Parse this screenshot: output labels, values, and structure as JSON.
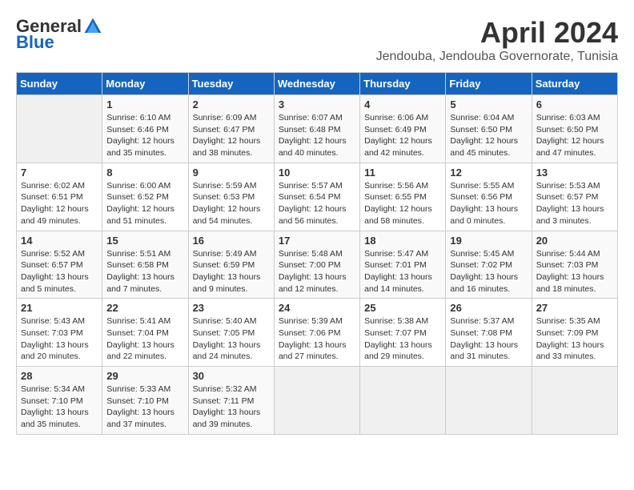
{
  "header": {
    "logo_general": "General",
    "logo_blue": "Blue",
    "month_title": "April 2024",
    "subtitle": "Jendouba, Jendouba Governorate, Tunisia"
  },
  "calendar": {
    "days_of_week": [
      "Sunday",
      "Monday",
      "Tuesday",
      "Wednesday",
      "Thursday",
      "Friday",
      "Saturday"
    ],
    "weeks": [
      [
        {
          "day": "",
          "info": ""
        },
        {
          "day": "1",
          "info": "Sunrise: 6:10 AM\nSunset: 6:46 PM\nDaylight: 12 hours\nand 35 minutes."
        },
        {
          "day": "2",
          "info": "Sunrise: 6:09 AM\nSunset: 6:47 PM\nDaylight: 12 hours\nand 38 minutes."
        },
        {
          "day": "3",
          "info": "Sunrise: 6:07 AM\nSunset: 6:48 PM\nDaylight: 12 hours\nand 40 minutes."
        },
        {
          "day": "4",
          "info": "Sunrise: 6:06 AM\nSunset: 6:49 PM\nDaylight: 12 hours\nand 42 minutes."
        },
        {
          "day": "5",
          "info": "Sunrise: 6:04 AM\nSunset: 6:50 PM\nDaylight: 12 hours\nand 45 minutes."
        },
        {
          "day": "6",
          "info": "Sunrise: 6:03 AM\nSunset: 6:50 PM\nDaylight: 12 hours\nand 47 minutes."
        }
      ],
      [
        {
          "day": "7",
          "info": "Sunrise: 6:02 AM\nSunset: 6:51 PM\nDaylight: 12 hours\nand 49 minutes."
        },
        {
          "day": "8",
          "info": "Sunrise: 6:00 AM\nSunset: 6:52 PM\nDaylight: 12 hours\nand 51 minutes."
        },
        {
          "day": "9",
          "info": "Sunrise: 5:59 AM\nSunset: 6:53 PM\nDaylight: 12 hours\nand 54 minutes."
        },
        {
          "day": "10",
          "info": "Sunrise: 5:57 AM\nSunset: 6:54 PM\nDaylight: 12 hours\nand 56 minutes."
        },
        {
          "day": "11",
          "info": "Sunrise: 5:56 AM\nSunset: 6:55 PM\nDaylight: 12 hours\nand 58 minutes."
        },
        {
          "day": "12",
          "info": "Sunrise: 5:55 AM\nSunset: 6:56 PM\nDaylight: 13 hours\nand 0 minutes."
        },
        {
          "day": "13",
          "info": "Sunrise: 5:53 AM\nSunset: 6:57 PM\nDaylight: 13 hours\nand 3 minutes."
        }
      ],
      [
        {
          "day": "14",
          "info": "Sunrise: 5:52 AM\nSunset: 6:57 PM\nDaylight: 13 hours\nand 5 minutes."
        },
        {
          "day": "15",
          "info": "Sunrise: 5:51 AM\nSunset: 6:58 PM\nDaylight: 13 hours\nand 7 minutes."
        },
        {
          "day": "16",
          "info": "Sunrise: 5:49 AM\nSunset: 6:59 PM\nDaylight: 13 hours\nand 9 minutes."
        },
        {
          "day": "17",
          "info": "Sunrise: 5:48 AM\nSunset: 7:00 PM\nDaylight: 13 hours\nand 12 minutes."
        },
        {
          "day": "18",
          "info": "Sunrise: 5:47 AM\nSunset: 7:01 PM\nDaylight: 13 hours\nand 14 minutes."
        },
        {
          "day": "19",
          "info": "Sunrise: 5:45 AM\nSunset: 7:02 PM\nDaylight: 13 hours\nand 16 minutes."
        },
        {
          "day": "20",
          "info": "Sunrise: 5:44 AM\nSunset: 7:03 PM\nDaylight: 13 hours\nand 18 minutes."
        }
      ],
      [
        {
          "day": "21",
          "info": "Sunrise: 5:43 AM\nSunset: 7:03 PM\nDaylight: 13 hours\nand 20 minutes."
        },
        {
          "day": "22",
          "info": "Sunrise: 5:41 AM\nSunset: 7:04 PM\nDaylight: 13 hours\nand 22 minutes."
        },
        {
          "day": "23",
          "info": "Sunrise: 5:40 AM\nSunset: 7:05 PM\nDaylight: 13 hours\nand 24 minutes."
        },
        {
          "day": "24",
          "info": "Sunrise: 5:39 AM\nSunset: 7:06 PM\nDaylight: 13 hours\nand 27 minutes."
        },
        {
          "day": "25",
          "info": "Sunrise: 5:38 AM\nSunset: 7:07 PM\nDaylight: 13 hours\nand 29 minutes."
        },
        {
          "day": "26",
          "info": "Sunrise: 5:37 AM\nSunset: 7:08 PM\nDaylight: 13 hours\nand 31 minutes."
        },
        {
          "day": "27",
          "info": "Sunrise: 5:35 AM\nSunset: 7:09 PM\nDaylight: 13 hours\nand 33 minutes."
        }
      ],
      [
        {
          "day": "28",
          "info": "Sunrise: 5:34 AM\nSunset: 7:10 PM\nDaylight: 13 hours\nand 35 minutes."
        },
        {
          "day": "29",
          "info": "Sunrise: 5:33 AM\nSunset: 7:10 PM\nDaylight: 13 hours\nand 37 minutes."
        },
        {
          "day": "30",
          "info": "Sunrise: 5:32 AM\nSunset: 7:11 PM\nDaylight: 13 hours\nand 39 minutes."
        },
        {
          "day": "",
          "info": ""
        },
        {
          "day": "",
          "info": ""
        },
        {
          "day": "",
          "info": ""
        },
        {
          "day": "",
          "info": ""
        }
      ]
    ]
  }
}
